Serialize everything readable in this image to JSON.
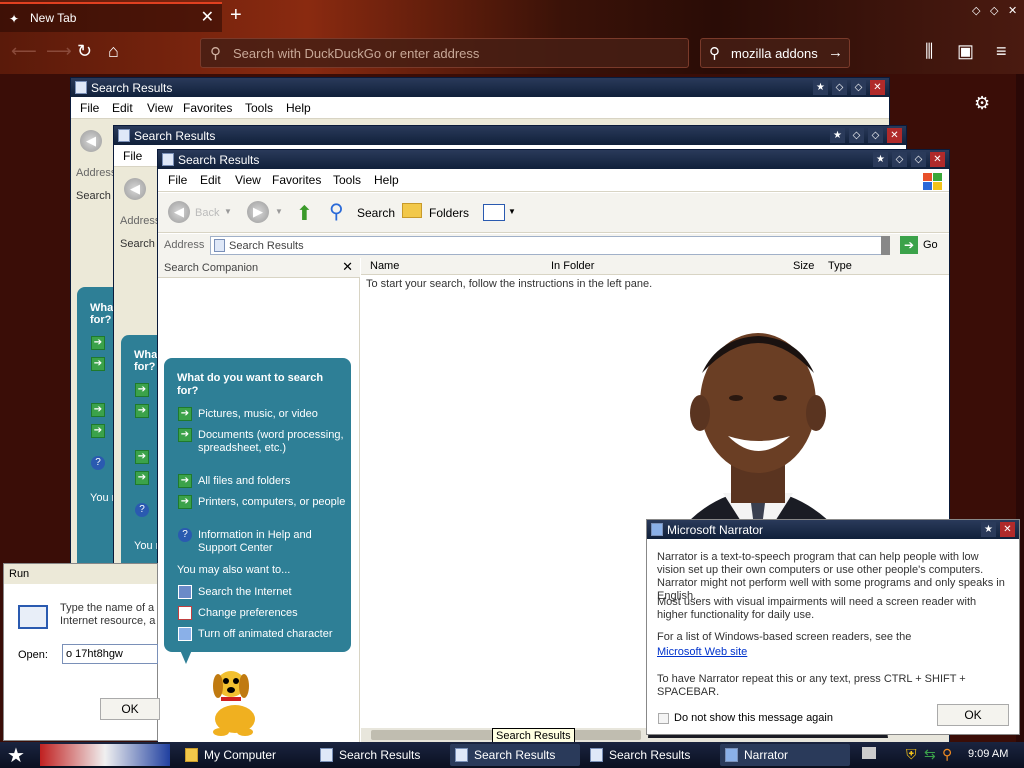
{
  "browser": {
    "tab_title": "New Tab",
    "tab_close": "✕",
    "new_tab": "+",
    "url_placeholder": "Search with DuckDuckGo or enter address",
    "search_value": "mozilla addons"
  },
  "back_windows": [
    {
      "title": "Search Results",
      "menu": [
        "File",
        "Edit",
        "View",
        "Favorites",
        "Tools",
        "Help"
      ],
      "address_label": "Address",
      "search_label": "Search",
      "bubble_title": "What do you want to search for?",
      "you_may": "You m"
    },
    {
      "title": "Search Results",
      "menu": [
        "File"
      ],
      "address_label": "Address",
      "search_label": "Search",
      "bubble_title": "What do you want to search for?",
      "you_may": "You m"
    }
  ],
  "main_window": {
    "title": "Search Results",
    "menu": [
      "File",
      "Edit",
      "View",
      "Favorites",
      "Tools",
      "Help"
    ],
    "toolbar": {
      "back": "Back",
      "search": "Search",
      "folders": "Folders"
    },
    "address_label": "Address",
    "address_value": "Search Results",
    "go_label": "Go",
    "companion_title": "Search Companion",
    "columns": [
      "Name",
      "In Folder",
      "Size",
      "Type"
    ],
    "instructions": "To start your search, follow the instructions in the left pane.",
    "bubble": {
      "title": "What do you want to search for?",
      "items": [
        "Pictures, music, or video",
        "Documents (word processing, spreadsheet, etc.)",
        "All files and folders",
        "Printers, computers, or people",
        "Information in Help and Support Center"
      ],
      "also_label": "You may also want to...",
      "also_items": [
        "Search the Internet",
        "Change preferences",
        "Turn off animated character"
      ]
    },
    "tooltip": "Search Results"
  },
  "run_dialog": {
    "title": "Run",
    "description": "Type the name of a program, folder, document, or Internet resource, and Windows will open it for you.",
    "description_visible": "Type the name of a\nInternet resource, a",
    "open_label": "Open:",
    "open_value": "o 17ht8hgw",
    "ok_label": "OK"
  },
  "narrator": {
    "title": "Microsoft Narrator",
    "p1": "Narrator is a text-to-speech program that can help people with low vision set up their own computers or use other people's computers. Narrator might not perform well with some programs and only speaks in English.",
    "p2": "Most users with visual impairments will need a screen reader with higher functionality for daily use.",
    "p3": "For a list of Windows-based screen readers, see the",
    "link": "Microsoft Web site",
    "p4": "To have Narrator repeat this or any text, press CTRL + SHIFT + SPACEBAR.",
    "checkbox_label": "Do not show this message again",
    "ok_label": "OK"
  },
  "taskbar": {
    "items": [
      "My Computer",
      "Search Results",
      "Search Results",
      "Search Results",
      "Narrator"
    ],
    "clock": "9:09 AM"
  },
  "colors": {
    "bubble": "#2e7f96",
    "titlebar": "#10203a",
    "close": "#b02a2a",
    "link": "#0033cc"
  }
}
